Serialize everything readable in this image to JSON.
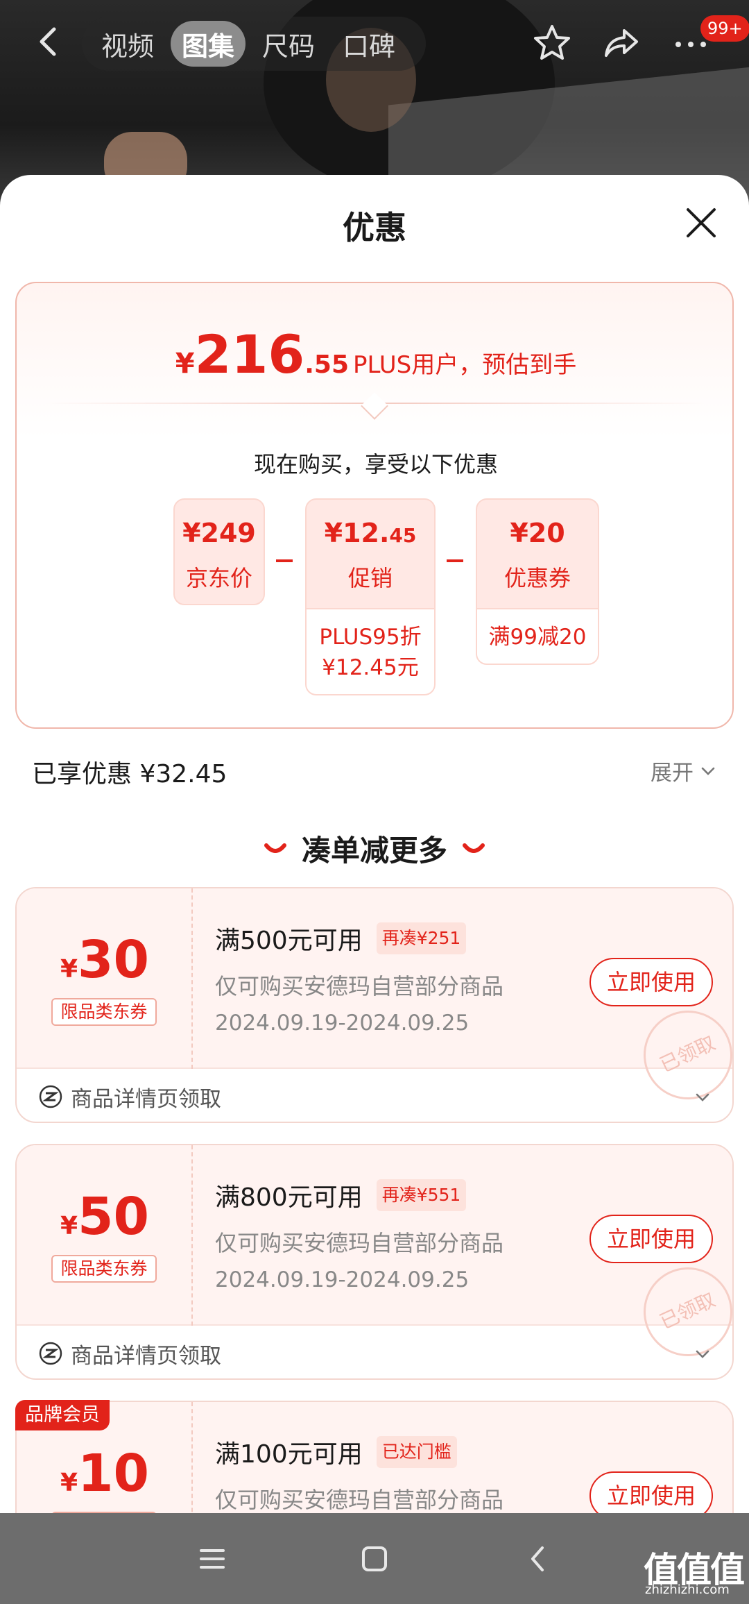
{
  "header": {
    "tabs": [
      "视频",
      "图集",
      "尺码",
      "口碑"
    ],
    "active_tab": "图集",
    "badge": "99+"
  },
  "sheet": {
    "title": "优惠",
    "estimate": {
      "currency": "¥",
      "integer": "216",
      "decimal": ".55",
      "label": "PLUS用户，预估到手"
    },
    "buy_now_text": "现在购买，享受以下优惠",
    "breakdown": [
      {
        "amount": "¥249",
        "name": "京东价",
        "extra": ""
      },
      {
        "amount_main": "¥12.",
        "amount_small": "45",
        "name": "促销",
        "extra_line1": "PLUS95折",
        "extra_line2": "¥12.45元"
      },
      {
        "amount": "¥20",
        "name": "优惠券",
        "extra": "满99减20"
      }
    ],
    "operators": [
      "-",
      "-"
    ],
    "saved_text": "已享优惠 ¥32.45",
    "expand_label": "展开",
    "more_title": "凑单减更多"
  },
  "coupons": [
    {
      "currency": "¥",
      "value": "30",
      "category": "限品类东券",
      "condition": "满500元可用",
      "tag": "再凑¥251",
      "desc": "仅可购买安德玛自营部分商品",
      "date": "2024.09.19-2024.09.25",
      "button": "立即使用",
      "stamp": "已领取",
      "footer": "商品详情页领取"
    },
    {
      "currency": "¥",
      "value": "50",
      "category": "限品类东券",
      "condition": "满800元可用",
      "tag": "再凑¥551",
      "desc": "仅可购买安德玛自营部分商品",
      "date": "2024.09.19-2024.09.25",
      "button": "立即使用",
      "stamp": "已领取",
      "footer": "商品详情页领取"
    },
    {
      "brand_tag": "品牌会员",
      "currency": "¥",
      "value": "10",
      "condition": "满100元可用",
      "tag": "已达门槛",
      "desc": "仅可购买安德玛自营部分商品",
      "button": "立即使用"
    }
  ],
  "watermark": {
    "main": "值值值",
    "sub": "zhizhizhi.com"
  },
  "colors": {
    "accent": "#e2231a",
    "chip_bg": "#ffe8e4",
    "coupon_bg": "#fff3f1",
    "navbar": "#6d6d6d"
  },
  "icons": [
    "back-icon",
    "star-icon",
    "share-icon",
    "more-icon",
    "close-icon",
    "chevron-down-icon",
    "coupon-source-icon",
    "menu-icon",
    "home-icon",
    "nav-back-icon"
  ]
}
